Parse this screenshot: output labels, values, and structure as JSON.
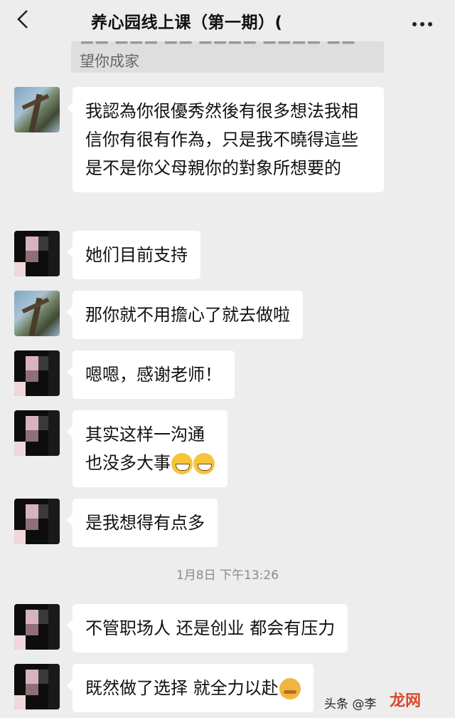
{
  "header": {
    "title": "养心园线上课（第一期）(",
    "back_icon": "chevron-left-icon",
    "more_icon": "more-dots-icon"
  },
  "quote": {
    "text": "望你成家"
  },
  "messages": [
    {
      "sender_avatar": "tree-avatar",
      "text": "我認為你很優秀然後有很多想法我相信你有很有作為，只是我不曉得這些是不是你父母親你的對象所想要的"
    },
    {
      "sender_avatar": "mosaic-avatar",
      "text": "她们目前支持"
    },
    {
      "sender_avatar": "tree-avatar",
      "text": "那你就不用擔心了就去做啦"
    },
    {
      "sender_avatar": "mosaic-avatar",
      "text": "嗯嗯，感谢老师！"
    },
    {
      "sender_avatar": "mosaic-avatar",
      "line1": "其实这样一沟通",
      "line2": "也没多大事"
    },
    {
      "sender_avatar": "mosaic-avatar",
      "text": "是我想得有点多"
    },
    {
      "sender_avatar": "mosaic-avatar",
      "text": "不管职场人 还是创业 都会有压力"
    },
    {
      "sender_avatar": "mosaic-avatar",
      "text": "既然做了选择 就全力以赴"
    }
  ],
  "timestamp": "1月8日 下午13:26",
  "watermark": {
    "text": "头条 @李",
    "logo_text": "龙网"
  }
}
